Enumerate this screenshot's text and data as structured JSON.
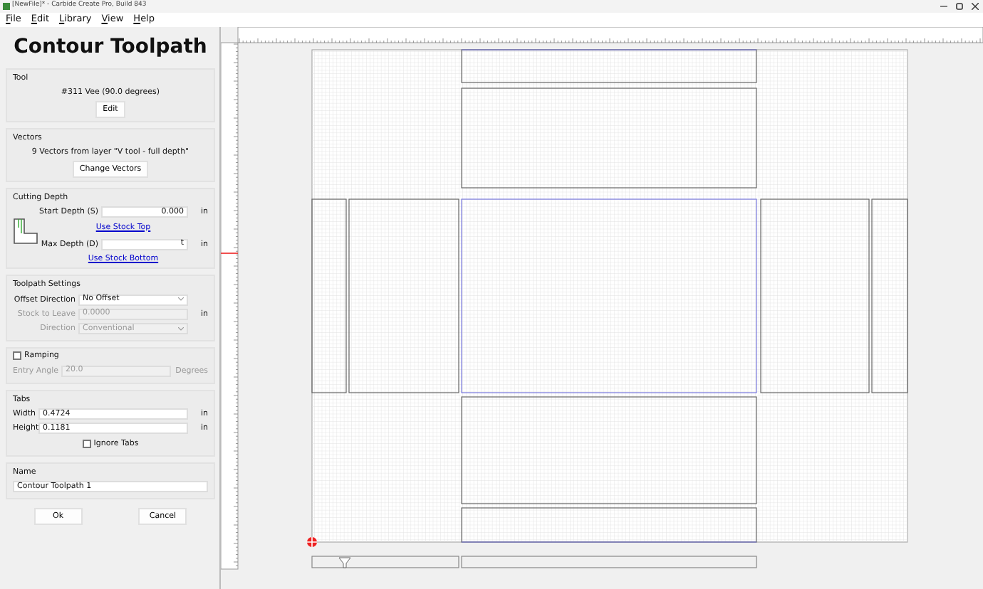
{
  "window": {
    "title": "[NewFile]* - Carbide Create Pro, Build 843"
  },
  "menu": [
    "File",
    "Edit",
    "Library",
    "View",
    "Help"
  ],
  "panel": {
    "title": "Contour Toolpath",
    "tool": {
      "heading": "Tool",
      "description": "#311 Vee (90.0 degrees)",
      "button": "Edit"
    },
    "vectors": {
      "heading": "Vectors",
      "description": "9 Vectors from layer \"V tool - full depth\"",
      "button": "Change Vectors"
    },
    "cutting_depth": {
      "heading": "Cutting Depth",
      "start": {
        "label": "Start Depth (S)",
        "value": "0.000",
        "unit": "in",
        "link": "Use Stock Top"
      },
      "max": {
        "label": "Max Depth (D)",
        "value": "t",
        "unit": "in",
        "link": "Use Stock Bottom"
      }
    },
    "toolpath_settings": {
      "heading": "Toolpath Settings",
      "fields": [
        {
          "label": "Offset Direction",
          "kind": "select",
          "value": "No Offset",
          "disabled": false
        },
        {
          "label": "Stock to Leave",
          "kind": "text",
          "value": "0.0000",
          "unit": "in",
          "disabled": true
        },
        {
          "label": "Direction",
          "kind": "select",
          "value": "Conventional",
          "disabled": true
        }
      ]
    },
    "ramping": {
      "label": "Ramping",
      "checked": false,
      "field": {
        "label": "Entry Angle",
        "value": "20.0",
        "unit": "Degrees",
        "disabled": true
      }
    },
    "tabs": {
      "heading": "Tabs",
      "fields": [
        {
          "label": "Width",
          "value": "0.4724",
          "unit": "in"
        },
        {
          "label": "Height",
          "value": "0.1181",
          "unit": "in"
        }
      ],
      "ignore": {
        "label": "Ignore Tabs",
        "checked": false
      }
    },
    "name": {
      "heading": "Name",
      "value": "Contour Toolpath 1"
    },
    "buttons": [
      "Ok",
      "Cancel"
    ]
  }
}
